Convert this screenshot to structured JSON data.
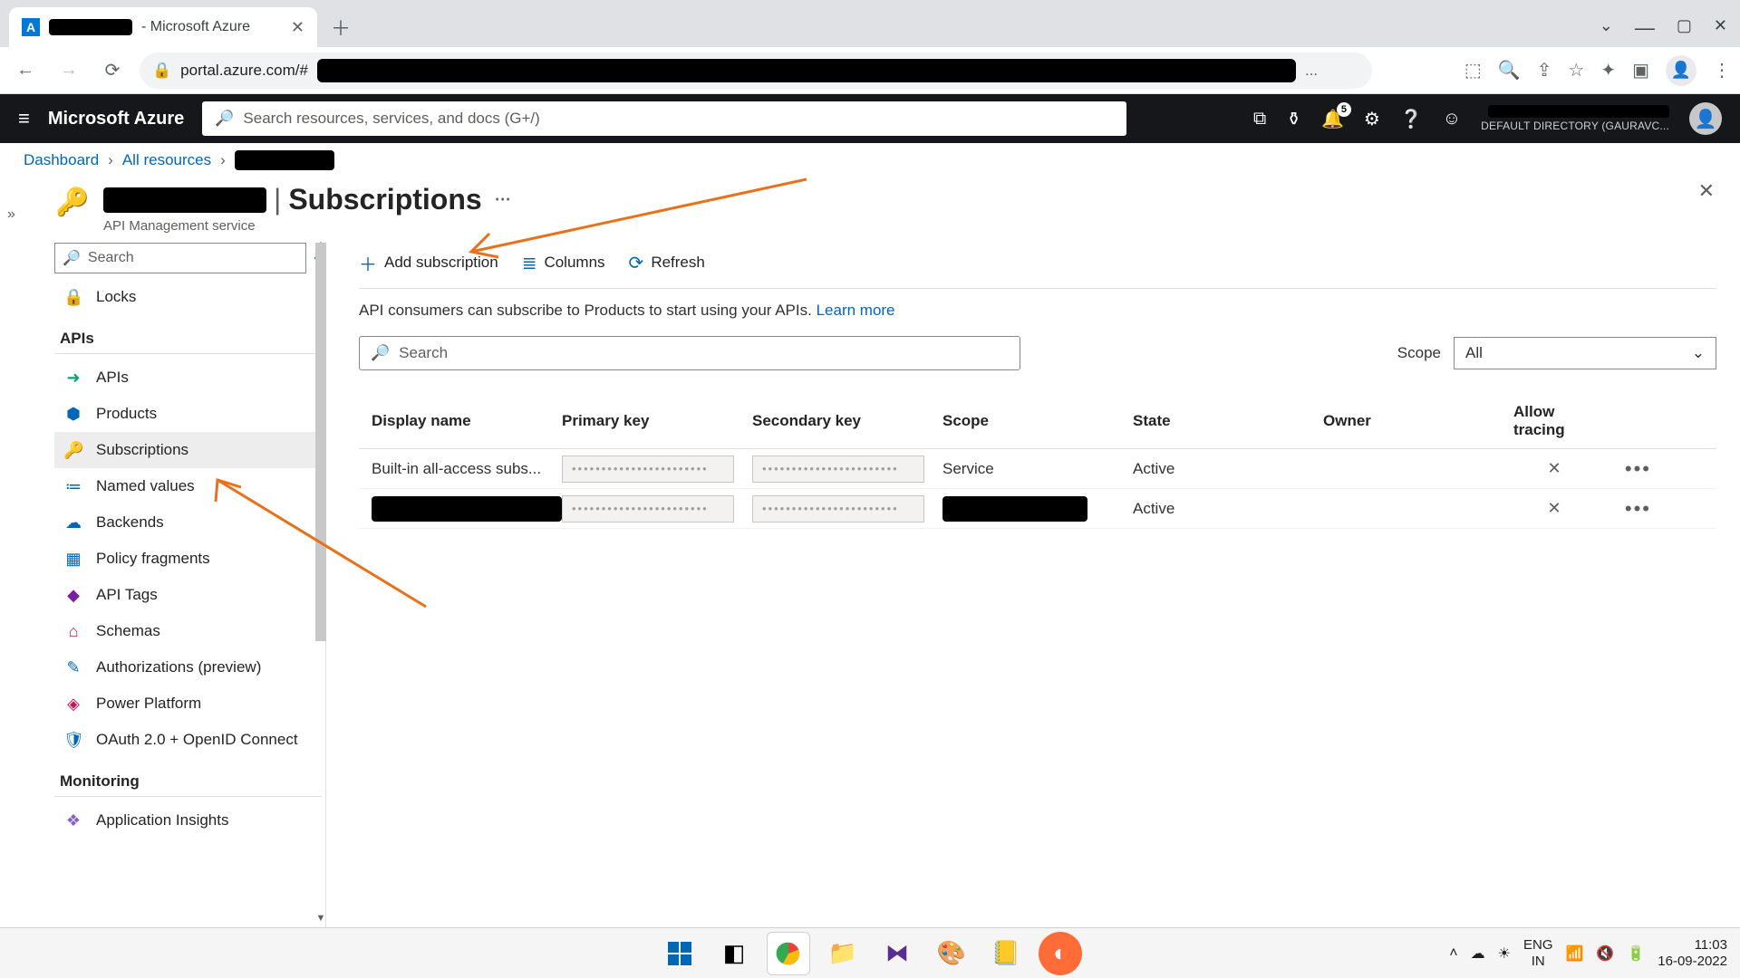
{
  "browser": {
    "tab_suffix": " - Microsoft Azure",
    "url_visible": "portal.azure.com/#"
  },
  "azure": {
    "brand": "Microsoft Azure",
    "search_placeholder": "Search resources, services, and docs (G+/)",
    "notification_count": "5",
    "directory_line": "DEFAULT DIRECTORY (GAURAVC..."
  },
  "crumbs": {
    "dashboard": "Dashboard",
    "all_resources": "All resources"
  },
  "page": {
    "title_suffix": "Subscriptions",
    "subtitle": "API Management service"
  },
  "sidebar": {
    "search_placeholder": "Search",
    "locks": "Locks",
    "group_apis": "APIs",
    "items": [
      "APIs",
      "Products",
      "Subscriptions",
      "Named values",
      "Backends",
      "Policy fragments",
      "API Tags",
      "Schemas",
      "Authorizations (preview)",
      "Power Platform",
      "OAuth 2.0 + OpenID Connect"
    ],
    "group_monitoring": "Monitoring",
    "monitoring_items": [
      "Application Insights"
    ]
  },
  "toolbar": {
    "add": "Add subscription",
    "columns": "Columns",
    "refresh": "Refresh"
  },
  "info": {
    "text": "API consumers can subscribe to Products to start using your APIs. ",
    "link": "Learn more"
  },
  "filters": {
    "search_placeholder": "Search",
    "scope_label": "Scope",
    "scope_value": "All"
  },
  "table": {
    "headers": {
      "display_name": "Display name",
      "primary_key": "Primary key",
      "secondary_key": "Secondary key",
      "scope": "Scope",
      "state": "State",
      "owner": "Owner",
      "allow_tracing": "Allow tracing"
    },
    "rows": [
      {
        "display_name": "Built-in all-access subs...",
        "scope": "Service",
        "state": "Active",
        "redacted": false
      },
      {
        "display_name": "",
        "scope": "",
        "state": "Active",
        "redacted": true
      }
    ]
  },
  "systray": {
    "lang1": "ENG",
    "lang2": "IN",
    "time": "11:03",
    "date": "16-09-2022"
  }
}
